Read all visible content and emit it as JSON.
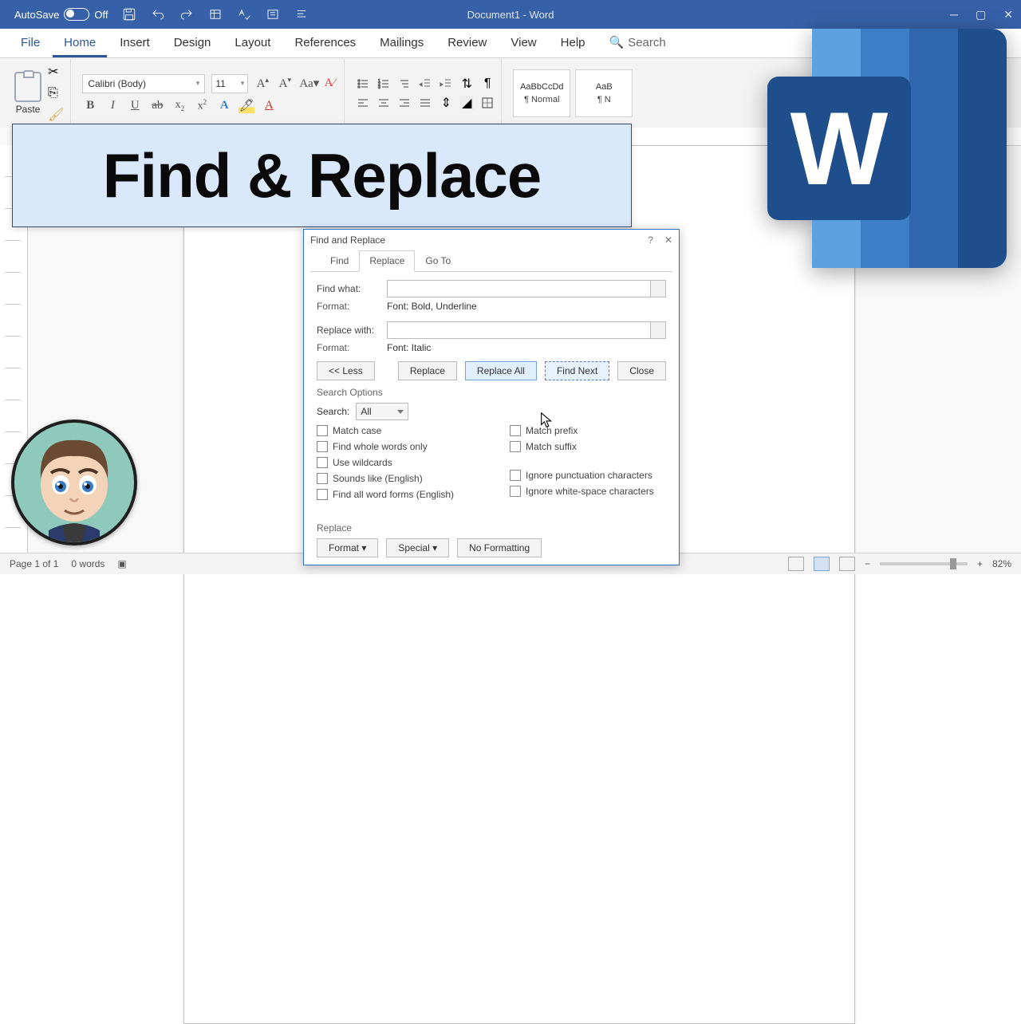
{
  "titlebar": {
    "autosave_label": "AutoSave",
    "autosave_state": "Off",
    "doc_title": "Document1  -  Word"
  },
  "tabs": {
    "file": "File",
    "home": "Home",
    "insert": "Insert",
    "design": "Design",
    "layout": "Layout",
    "references": "References",
    "mailings": "Mailings",
    "review": "Review",
    "view": "View",
    "help": "Help",
    "search": "Search"
  },
  "font": {
    "name": "Calibri (Body)",
    "size": "11"
  },
  "clipboard": {
    "paste": "Paste"
  },
  "styles": {
    "sample": "AaBbCcDd",
    "normal": "¶ Normal",
    "sample2": "AaB",
    "style2": "¶ N"
  },
  "banner": "Find & Replace",
  "dialog": {
    "title": "Find and Replace",
    "tabs": {
      "find": "Find",
      "replace": "Replace",
      "goto": "Go To"
    },
    "find_what": "Find what:",
    "format": "Format:",
    "find_format_val": "Font: Bold, Underline",
    "replace_with": "Replace with:",
    "replace_format_val": "Font: Italic",
    "less": "<< Less",
    "replace": "Replace",
    "replace_all": "Replace All",
    "find_next": "Find Next",
    "close": "Close",
    "search_options": "Search Options",
    "search_lbl": "Search:",
    "search_scope": "All",
    "checks_left": [
      "Match case",
      "Find whole words only",
      "Use wildcards",
      "Sounds like (English)",
      "Find all word forms (English)"
    ],
    "checks_right": [
      "Match prefix",
      "Match suffix",
      "Ignore punctuation characters",
      "Ignore white-space characters"
    ],
    "replace_section": "Replace",
    "format_btn": "Format ▾",
    "special_btn": "Special ▾",
    "no_formatting": "No Formatting"
  },
  "status": {
    "page": "Page 1 of 1",
    "words": "0 words",
    "zoom": "82%"
  }
}
